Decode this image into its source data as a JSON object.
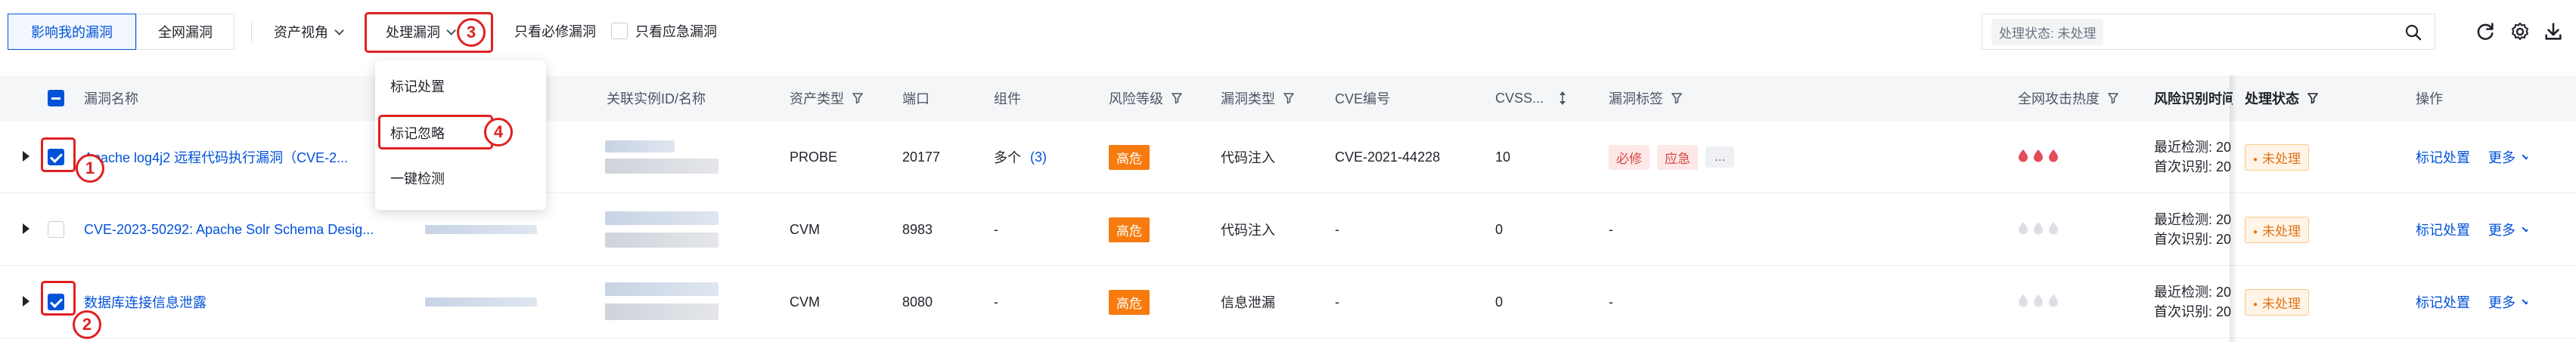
{
  "toolbar": {
    "tab_mine": "影响我的漏洞",
    "tab_all": "全网漏洞",
    "asset_view": "资产视角",
    "process_vuln": "处理漏洞",
    "only_must_fix": "只看必修漏洞",
    "only_emergency": "只看应急漏洞",
    "filter_tag": "处理状态: 未处理"
  },
  "menu": {
    "items": [
      "标记处置",
      "标记忽略",
      "一键检测"
    ]
  },
  "markers": [
    "1",
    "2",
    "3",
    "4"
  ],
  "columns": {
    "name": "漏洞名称",
    "instance": "关联实例ID/名称",
    "asset_type": "资产类型",
    "port": "端口",
    "component": "组件",
    "risk": "风险等级",
    "vuln_type": "漏洞类型",
    "cve": "CVE编号",
    "cvss": "CVSS...",
    "tags": "漏洞标签",
    "heat": "全网攻击热度",
    "risk_time": "风险识别时间",
    "status": "处理状态",
    "ops": "操作"
  },
  "rows": [
    {
      "name": "Apache log4j2 远程代码执行漏洞（CVE-2...",
      "checked": true,
      "asset_type": "PROBE",
      "port": "20177",
      "component": "多个",
      "component_count": "(3)",
      "risk": "高危",
      "vuln_type": "代码注入",
      "cve": "CVE-2021-44228",
      "cvss": "10",
      "tags": [
        "必修",
        "应急",
        "..."
      ],
      "heat": 3,
      "last_detect": "最近检测: 20",
      "first_detect": "首次识别: 20",
      "status": "未处理",
      "action": "标记处置",
      "more": "更多"
    },
    {
      "name": "CVE-2023-50292: Apache Solr Schema Desig...",
      "checked": false,
      "asset_type": "CVM",
      "port": "8983",
      "component": "-",
      "component_count": "",
      "risk": "高危",
      "vuln_type": "代码注入",
      "cve": "-",
      "cvss": "0",
      "tags": [],
      "tags_empty": "-",
      "heat": 0,
      "last_detect": "最近检测: 20",
      "first_detect": "首次识别: 20",
      "status": "未处理",
      "action": "标记处置",
      "more": "更多"
    },
    {
      "name": "数据库连接信息泄露",
      "checked": true,
      "asset_type": "CVM",
      "port": "8080",
      "component": "-",
      "component_count": "",
      "risk": "高危",
      "vuln_type": "信息泄漏",
      "cve": "-",
      "cvss": "0",
      "tags": [],
      "tags_empty": "-",
      "heat": 0,
      "last_detect": "最近检测: 20",
      "first_detect": "首次识别: 20",
      "status": "未处理",
      "action": "标记处置",
      "more": "更多"
    }
  ],
  "icons": {
    "search": "search-icon",
    "refresh": "refresh-icon",
    "settings": "gear-icon",
    "download": "download-icon",
    "filter": "filter-icon",
    "sort": "sort-icon",
    "heat": "flame-icon"
  },
  "colors": {
    "primary": "#0052d9",
    "risk_high": "#f77b0e",
    "heat_active": "#e34d59",
    "heat_inactive": "#dcdfe4",
    "highlight": "#e02020"
  }
}
